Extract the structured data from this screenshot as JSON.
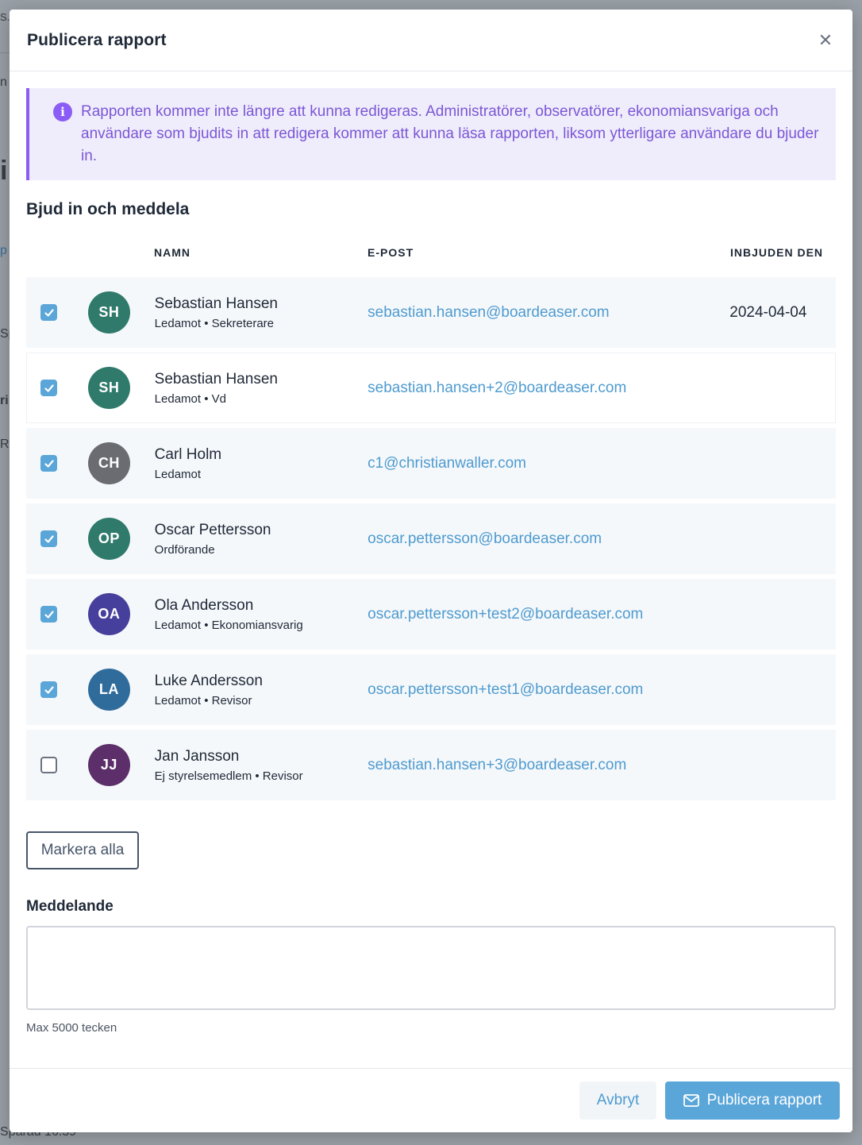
{
  "background": {
    "fragments": [
      "S...",
      "n",
      "i",
      "p",
      "Sp",
      "ri",
      "Ra",
      "Sparad 16.39"
    ]
  },
  "modal": {
    "title": "Publicera rapport",
    "close_icon": "close-icon",
    "info": {
      "icon": "info-icon",
      "text": "Rapporten kommer inte längre att kunna redigeras. Administratörer, observatörer, ekonomiansvariga och användare som bjudits in att redigera kommer att kunna läsa rapporten, liksom ytterligare användare du bjuder in."
    },
    "section_title": "Bjud in och meddela",
    "columns": {
      "name": "NAMN",
      "email": "E-POST",
      "invited": "INBJUDEN DEN"
    },
    "members": [
      {
        "initials": "SH",
        "name": "Sebastian Hansen",
        "role": "Ledamot • Sekreterare",
        "email": "sebastian.hansen@boardeaser.com",
        "invited": "2024-04-04",
        "checked": true,
        "color": "#2f7a6b"
      },
      {
        "initials": "SH",
        "name": "Sebastian Hansen",
        "role": "Ledamot • Vd",
        "email": "sebastian.hansen+2@boardeaser.com",
        "invited": "",
        "checked": true,
        "color": "#2f7a6b"
      },
      {
        "initials": "CH",
        "name": "Carl Holm",
        "role": "Ledamot",
        "email": "c1@christianwaller.com",
        "invited": "",
        "checked": true,
        "color": "#6b6c72"
      },
      {
        "initials": "OP",
        "name": "Oscar Pettersson",
        "role": "Ordförande",
        "email": "oscar.pettersson@boardeaser.com",
        "invited": "",
        "checked": true,
        "color": "#2f7a6b"
      },
      {
        "initials": "OA",
        "name": "Ola Andersson",
        "role": "Ledamot • Ekonomiansvarig",
        "email": "oscar.pettersson+test2@boardeaser.com",
        "invited": "",
        "checked": true,
        "color": "#473f9c"
      },
      {
        "initials": "LA",
        "name": "Luke Andersson",
        "role": "Ledamot • Revisor",
        "email": "oscar.pettersson+test1@boardeaser.com",
        "invited": "",
        "checked": true,
        "color": "#2f6c9c"
      },
      {
        "initials": "JJ",
        "name": "Jan Jansson",
        "role": "Ej styrelsemedlem • Revisor",
        "email": "sebastian.hansen+3@boardeaser.com",
        "invited": "",
        "checked": false,
        "color": "#5c2f6a"
      }
    ],
    "select_all_label": "Markera alla",
    "message": {
      "label": "Meddelande",
      "value": "",
      "hint": "Max 5000 tecken"
    },
    "footer": {
      "cancel_label": "Avbryt",
      "publish_label": "Publicera rapport",
      "publish_icon": "mail-icon"
    }
  }
}
